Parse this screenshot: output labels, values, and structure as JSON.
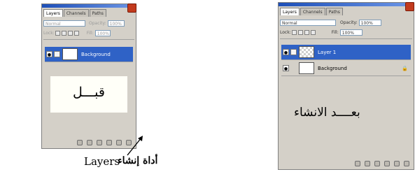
{
  "left_panel": {
    "tabs": [
      "Layers",
      "Channels",
      "Paths"
    ],
    "blend_mode": "Normal",
    "opacity_label": "Opacity:",
    "opacity_value": "100%",
    "lock_label": "Lock:",
    "fill_label": "Fill:",
    "fill_value": "100%",
    "layers": [
      {
        "name": "Background",
        "selected": true
      }
    ],
    "before_label": "قبـــل"
  },
  "right_panel": {
    "tabs": [
      "Layers",
      "Channels",
      "Paths"
    ],
    "blend_mode": "Normal",
    "opacity_label": "Opacity:",
    "opacity_value": "100%",
    "lock_label": "Lock:",
    "fill_label": "Fill:",
    "fill_value": "100%",
    "layers": [
      {
        "name": "Layer 1",
        "selected": true
      },
      {
        "name": "Background",
        "selected": false
      }
    ],
    "after_label": "بعــــد الانشاء"
  },
  "bottom_caption": {
    "latin": "Layers",
    "arabic": "أداة إنشاء"
  }
}
